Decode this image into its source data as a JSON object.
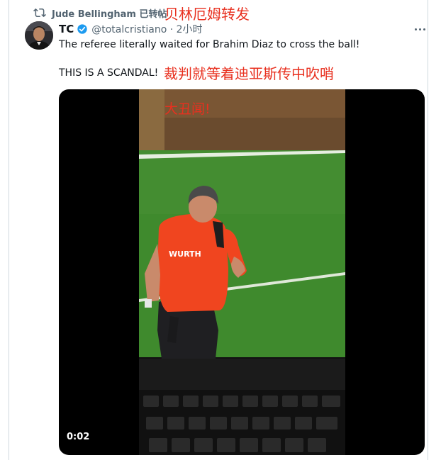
{
  "retweet": {
    "label": "Jude Bellingham 已转帖"
  },
  "annotations": {
    "top": "贝林厄姆转发",
    "middle": "裁判就等着迪亚斯传中吹哨",
    "video": "大丑闻!"
  },
  "tweet": {
    "name": "TC",
    "handle": "@totalcristiano · 2小时",
    "line1": "The referee literally waited for Brahim Diaz to cross the ball!",
    "line2": "THIS IS A SCANDAL!"
  },
  "video": {
    "timestamp": "0:02",
    "jersey_sponsor": "WURTH"
  },
  "colors": {
    "verified": "#1d9bf0",
    "annotation": "#e8301f",
    "muted": "#536471",
    "pitch": "#3f8a2d",
    "referee_shirt": "#f0451f"
  },
  "icons": {
    "retweet": "retweet-icon",
    "verified": "verified-badge-icon",
    "more": "more-options-icon"
  }
}
